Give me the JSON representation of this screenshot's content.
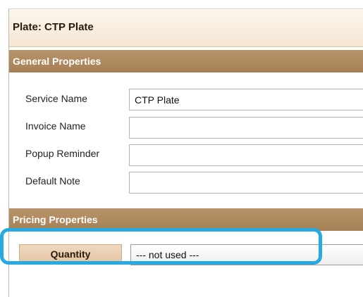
{
  "header": {
    "title": "Plate: CTP Plate"
  },
  "sections": {
    "general": "General Properties",
    "pricing": "Pricing Properties"
  },
  "fields": {
    "service_name": {
      "label": "Service Name",
      "value": "CTP Plate"
    },
    "invoice_name": {
      "label": "Invoice Name",
      "value": ""
    },
    "popup_reminder": {
      "label": "Popup Reminder",
      "value": ""
    },
    "default_note": {
      "label": "Default Note",
      "value": ""
    }
  },
  "pricing": {
    "quantity_label": "Quantity",
    "quantity_selected": "--- not used ---"
  },
  "colors": {
    "section_header": "#a67f55",
    "title_bar": "#f5e6d3",
    "highlight": "#27a9e1"
  }
}
